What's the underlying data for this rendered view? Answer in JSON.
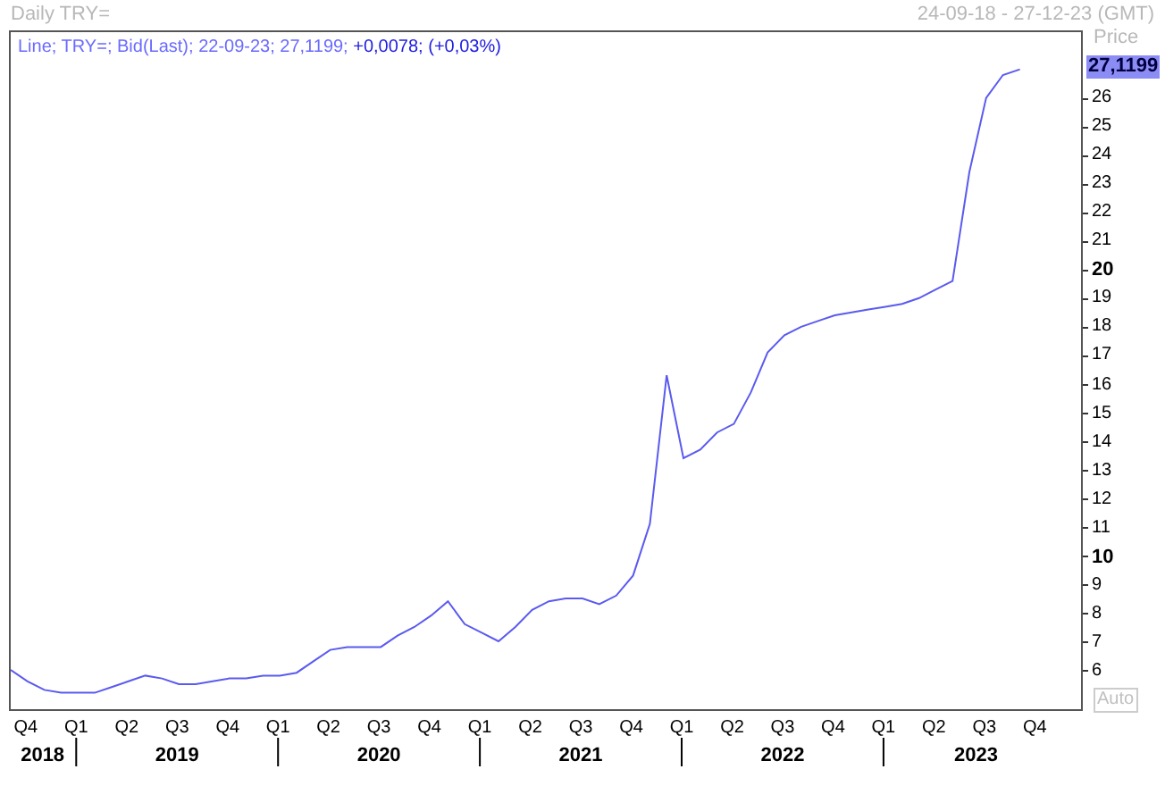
{
  "window": {
    "title": "Daily TRY=",
    "date_range": "24-09-18 - 27-12-23 (GMT)"
  },
  "chart": {
    "legend": {
      "info": "Line; TRY=; Bid(Last); 22-09-23; 27,1199;",
      "change": "+0,0078; (+0,03%)"
    },
    "axis_label": "Price",
    "last_price": "27,1199",
    "scale_button": "Auto",
    "year_labels": [
      "2018",
      "2019",
      "2020",
      "2021",
      "2022",
      "2023"
    ],
    "chart_data": {
      "type": "line",
      "categories": [
        null,
        "Q4",
        null,
        null,
        "Q1",
        null,
        null,
        "Q2",
        null,
        null,
        "Q3",
        null,
        null,
        "Q4",
        null,
        null,
        "Q1",
        null,
        null,
        "Q2",
        null,
        null,
        "Q3",
        null,
        null,
        "Q4",
        null,
        null,
        "Q1",
        null,
        null,
        "Q2",
        null,
        null,
        "Q3",
        null,
        null,
        "Q4",
        null,
        null,
        "Q1",
        null,
        null,
        "Q2",
        null,
        null,
        "Q3",
        null,
        null,
        "Q4",
        null,
        null,
        "Q1",
        null,
        null,
        "Q2",
        null,
        null,
        "Q3",
        null,
        null,
        "Q4",
        null,
        null
      ],
      "series": [
        {
          "color": "#5a5af0",
          "values": [
            6.1,
            5.7,
            5.4,
            5.3,
            5.3,
            5.3,
            5.5,
            5.7,
            5.9,
            5.8,
            5.6,
            5.6,
            5.7,
            5.8,
            5.8,
            5.9,
            5.9,
            6.0,
            6.4,
            6.8,
            6.9,
            6.9,
            6.9,
            7.3,
            7.6,
            8.0,
            8.5,
            7.7,
            7.4,
            7.1,
            7.6,
            8.2,
            8.5,
            8.6,
            8.6,
            8.4,
            8.7,
            9.4,
            11.2,
            16.4,
            13.5,
            13.8,
            14.4,
            14.7,
            15.8,
            17.2,
            17.8,
            18.1,
            18.3,
            18.5,
            18.6,
            18.7,
            18.8,
            18.9,
            19.1,
            19.4,
            19.7,
            23.5,
            26.1,
            26.9,
            27.1,
            null,
            null,
            null
          ]
        }
      ],
      "ylim": [
        4.6,
        28.4
      ],
      "yticks": [
        6,
        7,
        8,
        9,
        10,
        11,
        12,
        13,
        14,
        15,
        16,
        17,
        18,
        19,
        20,
        21,
        22,
        23,
        24,
        25,
        26
      ]
    }
  }
}
